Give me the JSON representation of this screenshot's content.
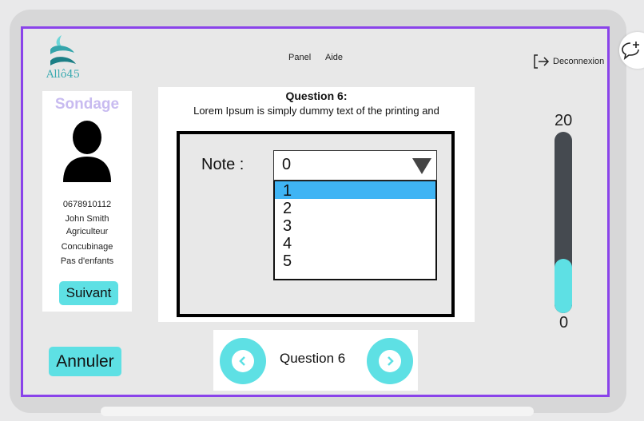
{
  "brand": {
    "name": "Allô45"
  },
  "nav": {
    "items": [
      "Panel",
      "Aide"
    ],
    "logout_label": "Deconnexion"
  },
  "profile": {
    "title": "Sondage",
    "phone": "0678910112",
    "name": "John Smith",
    "job": "Agriculteur",
    "status": "Concubinage",
    "children": "Pas d'enfants",
    "next_label": "Suivant"
  },
  "question": {
    "title": "Question 6:",
    "text": "Lorem Ipsum is simply dummy text of the printing and",
    "note_label": "Note :",
    "selected_value": "0",
    "options": [
      "1",
      "2",
      "3",
      "4",
      "5"
    ],
    "highlighted_option": "1"
  },
  "actions": {
    "cancel_label": "Annuler"
  },
  "pager": {
    "label": "Question 6"
  },
  "scale": {
    "max_label": "20",
    "min_label": "0",
    "max": 20,
    "min": 0,
    "value": 6
  },
  "colors": {
    "accent": "#5ee0e4",
    "frame": "#8a43ea",
    "highlight": "#3fb4f4",
    "title": "#c8bbf0"
  }
}
